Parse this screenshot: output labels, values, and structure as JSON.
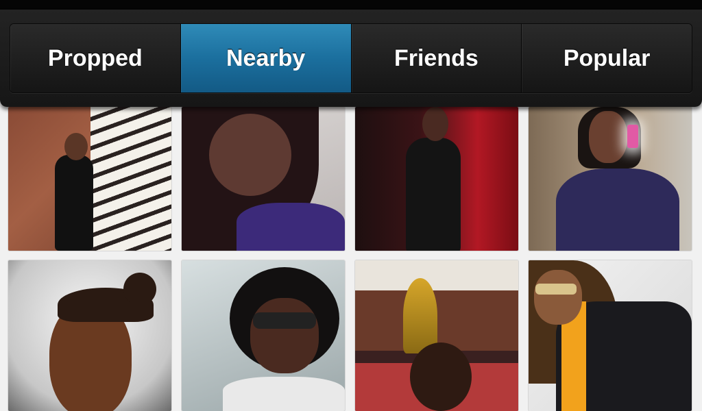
{
  "tabs": [
    {
      "label": "Propped",
      "active": false
    },
    {
      "label": "Nearby",
      "active": true
    },
    {
      "label": "Friends",
      "active": false
    },
    {
      "label": "Popular",
      "active": false
    }
  ],
  "colors": {
    "active_tab": "#1b6f9e",
    "tab_bar": "#1c1c1c",
    "grid_background": "#f1f1f1"
  },
  "grid": {
    "photos": [
      {
        "name": "photo-1"
      },
      {
        "name": "photo-2"
      },
      {
        "name": "photo-3"
      },
      {
        "name": "photo-4"
      },
      {
        "name": "photo-5"
      },
      {
        "name": "photo-6"
      },
      {
        "name": "photo-7"
      },
      {
        "name": "photo-8"
      }
    ]
  }
}
